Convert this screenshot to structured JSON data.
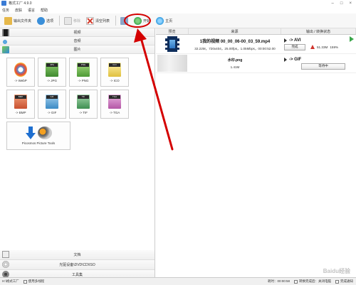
{
  "window": {
    "title": "格式工厂 4.9.0",
    "buttons": [
      "–",
      "□",
      "×"
    ]
  },
  "menu": [
    "任务",
    "皮肤",
    "语言",
    "帮助"
  ],
  "toolbar": {
    "items": [
      {
        "label": "输出文件夹",
        "icon": "folder-icon",
        "enabled": true,
        "color": "#e6b84a"
      },
      {
        "label": "选项",
        "icon": "options-icon",
        "enabled": true,
        "color": "#3a8fd9"
      },
      {
        "label": "移除",
        "icon": "remove-icon",
        "enabled": false,
        "color": "#bdbdbd"
      },
      {
        "label": "清空列表",
        "icon": "clear-list-icon",
        "enabled": true,
        "color": "#d33b2c"
      },
      {
        "label": "",
        "icon": "stop-icon",
        "enabled": true,
        "color": "#8aa5c8"
      },
      {
        "label": "开始",
        "icon": "start-icon",
        "enabled": true,
        "color": "#3aa64a"
      },
      {
        "label": "主页",
        "icon": "home-icon",
        "enabled": true,
        "color": "#2f9be0"
      }
    ]
  },
  "left": {
    "categories": {
      "video": "视频",
      "audio": "音频",
      "image": "图片",
      "document": "文档",
      "disc": "光驱设备\\DVD\\CD\\ISO",
      "tools": "工具集"
    },
    "image_formats": [
      {
        "label": "-> WebP",
        "tag": "",
        "color": "#4a90d9"
      },
      {
        "label": "-> JPG",
        "tag": "JPG",
        "color": "#5fa84a"
      },
      {
        "label": "-> PNG",
        "tag": "PNG",
        "color": "#6bb34d"
      },
      {
        "label": "-> ICO",
        "tag": "ICO",
        "color": "#e0c040"
      },
      {
        "label": "-> BMP",
        "tag": "BMP",
        "color": "#d95a3a"
      },
      {
        "label": "-> GIF",
        "tag": "GIF",
        "color": "#4a9bd0"
      },
      {
        "label": "-> TIF",
        "tag": "TIF",
        "color": "#5aa66a"
      },
      {
        "label": "-> TGA",
        "tag": "TGA",
        "color": "#c466b8"
      }
    ],
    "tools_tile_label": "Picosmos Picture Tools"
  },
  "table": {
    "headers": [
      "预览",
      "来源",
      "输出 / 转换状态"
    ],
    "rows": [
      {
        "filename": "1我的视频 00_00_06-00_03_59.mp4",
        "meta": "32.22M，720x404，25.00fps，1.05Mbps，00:00:52.00",
        "output_type": "-> AVI",
        "status": "完成",
        "size": "51.33M",
        "percent": "159%"
      },
      {
        "filename": "水印.png",
        "meta": "1.41M",
        "output_type": "-> GIF",
        "status": "等待中"
      }
    ]
  },
  "statusbar": {
    "folder": "H:\\格式工厂",
    "multithread": "使用多线程",
    "elapsed": "耗时：00:00:58",
    "after_convert": "转换完成后：关闭电脑",
    "notify": "完成通知"
  },
  "watermark": "Baidu经验",
  "annotation_color": "#d40000"
}
